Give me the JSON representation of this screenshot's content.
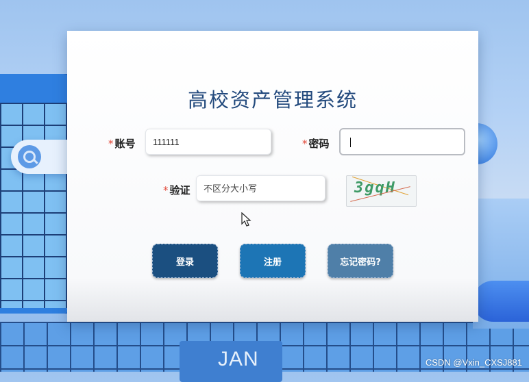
{
  "form": {
    "title": "高校资产管理系统",
    "required_mark": "*",
    "account": {
      "label": "账号",
      "value": "111111"
    },
    "password": {
      "label": "密码",
      "value": ""
    },
    "captcha": {
      "label": "验证",
      "placeholder": "不区分大小写",
      "image_text": "3gqH"
    }
  },
  "buttons": {
    "login": {
      "label": "登录",
      "color": "#1b4f80"
    },
    "register": {
      "label": "注册",
      "color": "#1d75b5"
    },
    "forgot": {
      "label": "忘记密码?",
      "color": "#4f7fa8"
    }
  },
  "background": {
    "calendar_text": "JAN"
  },
  "watermark": "CSDN @Vxin_CXSJ881",
  "colors": {
    "title": "#234a7d",
    "required": "#e24a3b"
  }
}
